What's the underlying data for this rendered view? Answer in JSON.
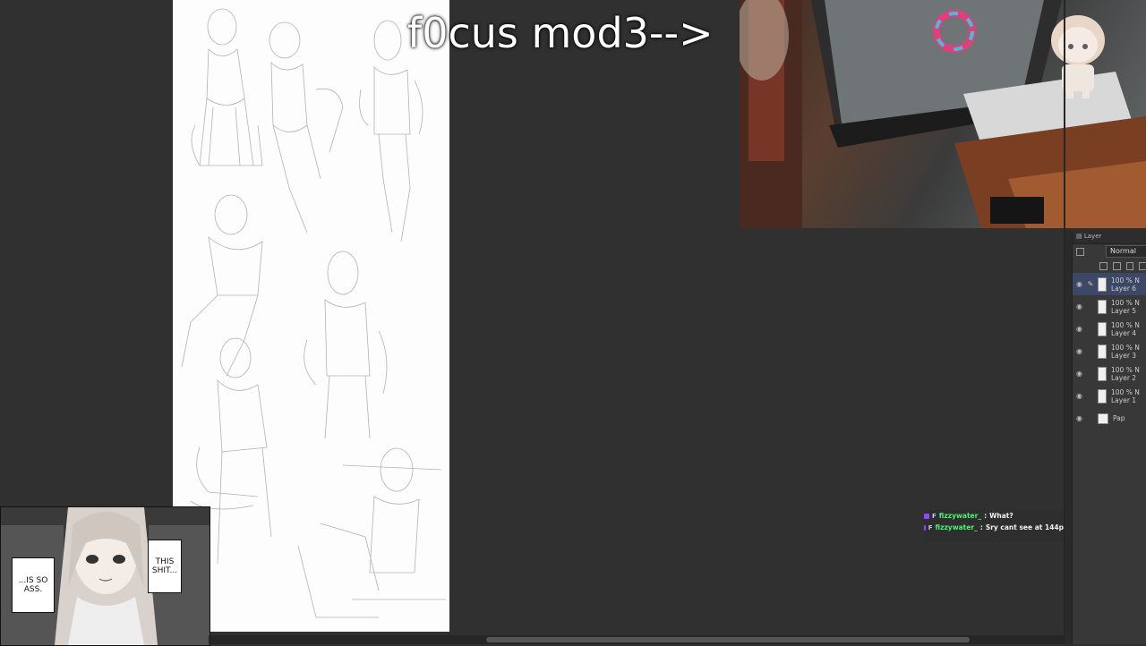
{
  "overlay": {
    "title": "f0cus mod3-->"
  },
  "layer_panel": {
    "tab_label": "Layer",
    "blend_mode": "Normal",
    "layers": [
      {
        "opacity": "100 % N",
        "name": "Layer 6",
        "active": true
      },
      {
        "opacity": "100 % N",
        "name": "Layer 5",
        "active": false
      },
      {
        "opacity": "100 % N",
        "name": "Layer 4",
        "active": false
      },
      {
        "opacity": "100 % N",
        "name": "Layer 3",
        "active": false
      },
      {
        "opacity": "100 % N",
        "name": "Layer 2",
        "active": false
      },
      {
        "opacity": "100 % N",
        "name": "Layer 1",
        "active": false
      }
    ],
    "paper_label": "Pap"
  },
  "chat": {
    "messages": [
      {
        "user": "fizzywater_",
        "text": "What?"
      },
      {
        "user": "fizzywater_",
        "text": "Sry cant see at 144p"
      }
    ]
  },
  "manga": {
    "bubble_left": "...IS SO ASS.",
    "bubble_right": "THIS SHIT..."
  },
  "icons": {
    "eye": "eye-icon",
    "pen": "pen-icon",
    "layers": "layers-icon"
  }
}
